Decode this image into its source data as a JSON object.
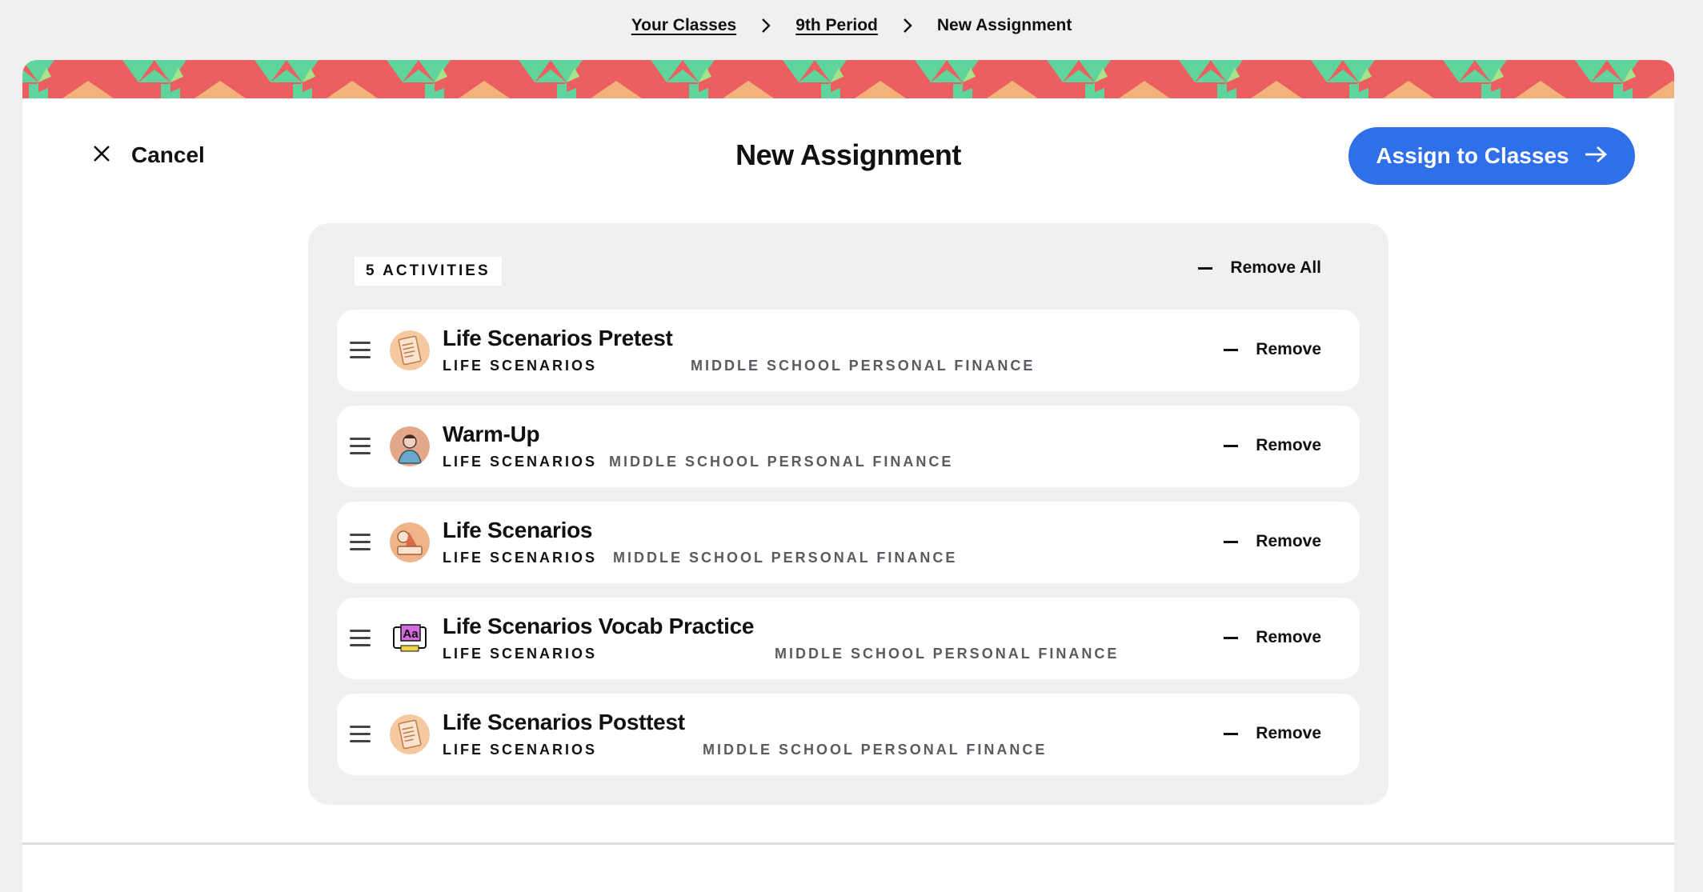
{
  "breadcrumb": {
    "items": [
      "Your Classes",
      "9th Period"
    ],
    "current": "New Assignment"
  },
  "header": {
    "cancel_label": "Cancel",
    "title": "New Assignment",
    "assign_label": "Assign to Classes"
  },
  "activities": {
    "count_label": "5 ACTIVITIES",
    "remove_all_label": "Remove All",
    "remove_label": "Remove",
    "items": [
      {
        "title": "Life Scenarios Pretest",
        "unit": "LIFE SCENARIOS",
        "course": "MIDDLE SCHOOL PERSONAL FINANCE",
        "icon": "worksheet-icon"
      },
      {
        "title": "Warm-Up",
        "unit": "LIFE SCENARIOS",
        "course": "MIDDLE SCHOOL PERSONAL FINANCE",
        "icon": "person-avatar-icon"
      },
      {
        "title": "Life Scenarios",
        "unit": "LIFE SCENARIOS",
        "course": "MIDDLE SCHOOL PERSONAL FINANCE",
        "icon": "scenario-illustration-icon"
      },
      {
        "title": "Life Scenarios Vocab Practice",
        "unit": "LIFE SCENARIOS",
        "course": "MIDDLE SCHOOL PERSONAL FINANCE",
        "icon": "vocab-aa-icon"
      },
      {
        "title": "Life Scenarios Posttest",
        "unit": "LIFE SCENARIOS",
        "course": "MIDDLE SCHOOL PERSONAL FINANCE",
        "icon": "worksheet-icon"
      }
    ]
  },
  "colors": {
    "accent": "#2f6fe8",
    "banner_red": "#ec5f61",
    "banner_green": "#5fd49c",
    "banner_orange": "#f4b27b",
    "banner_lightgreen": "#a6e38b"
  }
}
